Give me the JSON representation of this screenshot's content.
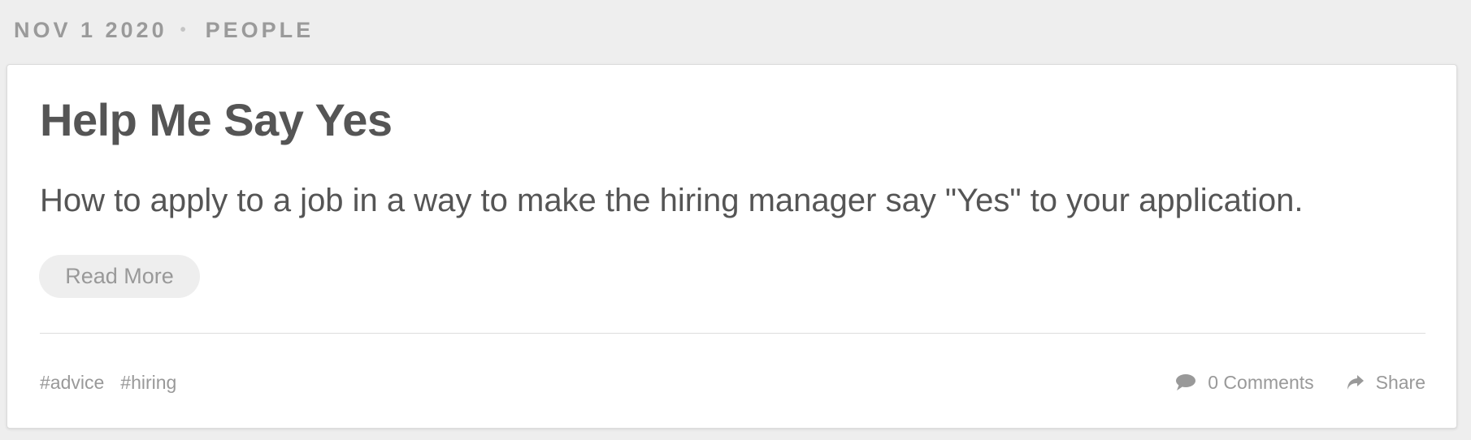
{
  "post_meta": {
    "date": "NOV 1 2020",
    "separator": "•",
    "category": "PEOPLE"
  },
  "card": {
    "title": "Help Me Say Yes",
    "excerpt": "How to apply to a job in a way to make the hiring manager say \"Yes\" to your application.",
    "read_more_label": "Read More",
    "tags": [
      "#advice",
      "#hiring"
    ],
    "comments_label": "0 Comments",
    "share_label": "Share",
    "icons": {
      "comments": "speech-bubble-icon",
      "share": "share-arrow-icon"
    }
  },
  "colors": {
    "page_background": "#eeeeee",
    "card_background": "#ffffff",
    "title_text": "#555555",
    "muted_text": "#999999",
    "button_background": "#eeeeee"
  }
}
